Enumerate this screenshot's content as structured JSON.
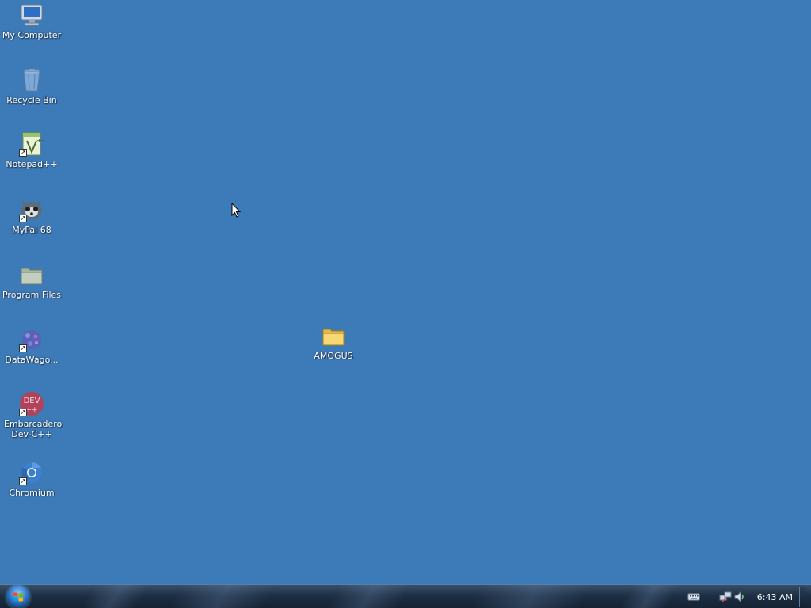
{
  "desktop": {
    "icons": [
      {
        "label": "My Computer",
        "icon": "computer-icon",
        "shortcut": false
      },
      {
        "label": "Recycle Bin",
        "icon": "recycle-bin-icon",
        "shortcut": false
      },
      {
        "label": "Notepad++",
        "icon": "notepad-plus-plus-icon",
        "shortcut": true
      },
      {
        "label": "MyPal 68",
        "icon": "mypal-browser-icon",
        "shortcut": true
      },
      {
        "label": "Program Files",
        "icon": "folder-icon",
        "shortcut": false
      },
      {
        "label": "DataWago...",
        "icon": "datawagon-icon",
        "shortcut": true
      },
      {
        "label": "Embarcadero Dev-C++",
        "icon": "dev-cpp-icon",
        "shortcut": true,
        "badge": "DEV"
      },
      {
        "label": "Chromium",
        "icon": "chromium-icon",
        "shortcut": true
      },
      {
        "label": "AMOGUS",
        "icon": "folder-icon",
        "shortcut": false
      }
    ],
    "background_color": "#3d7ab8"
  },
  "taskbar": {
    "start_button": {
      "icon": "windows-logo-icon"
    },
    "tray": {
      "icons": [
        "keyboard-icon",
        "network-icon",
        "volume-icon"
      ],
      "clock": "6:43 AM"
    }
  }
}
